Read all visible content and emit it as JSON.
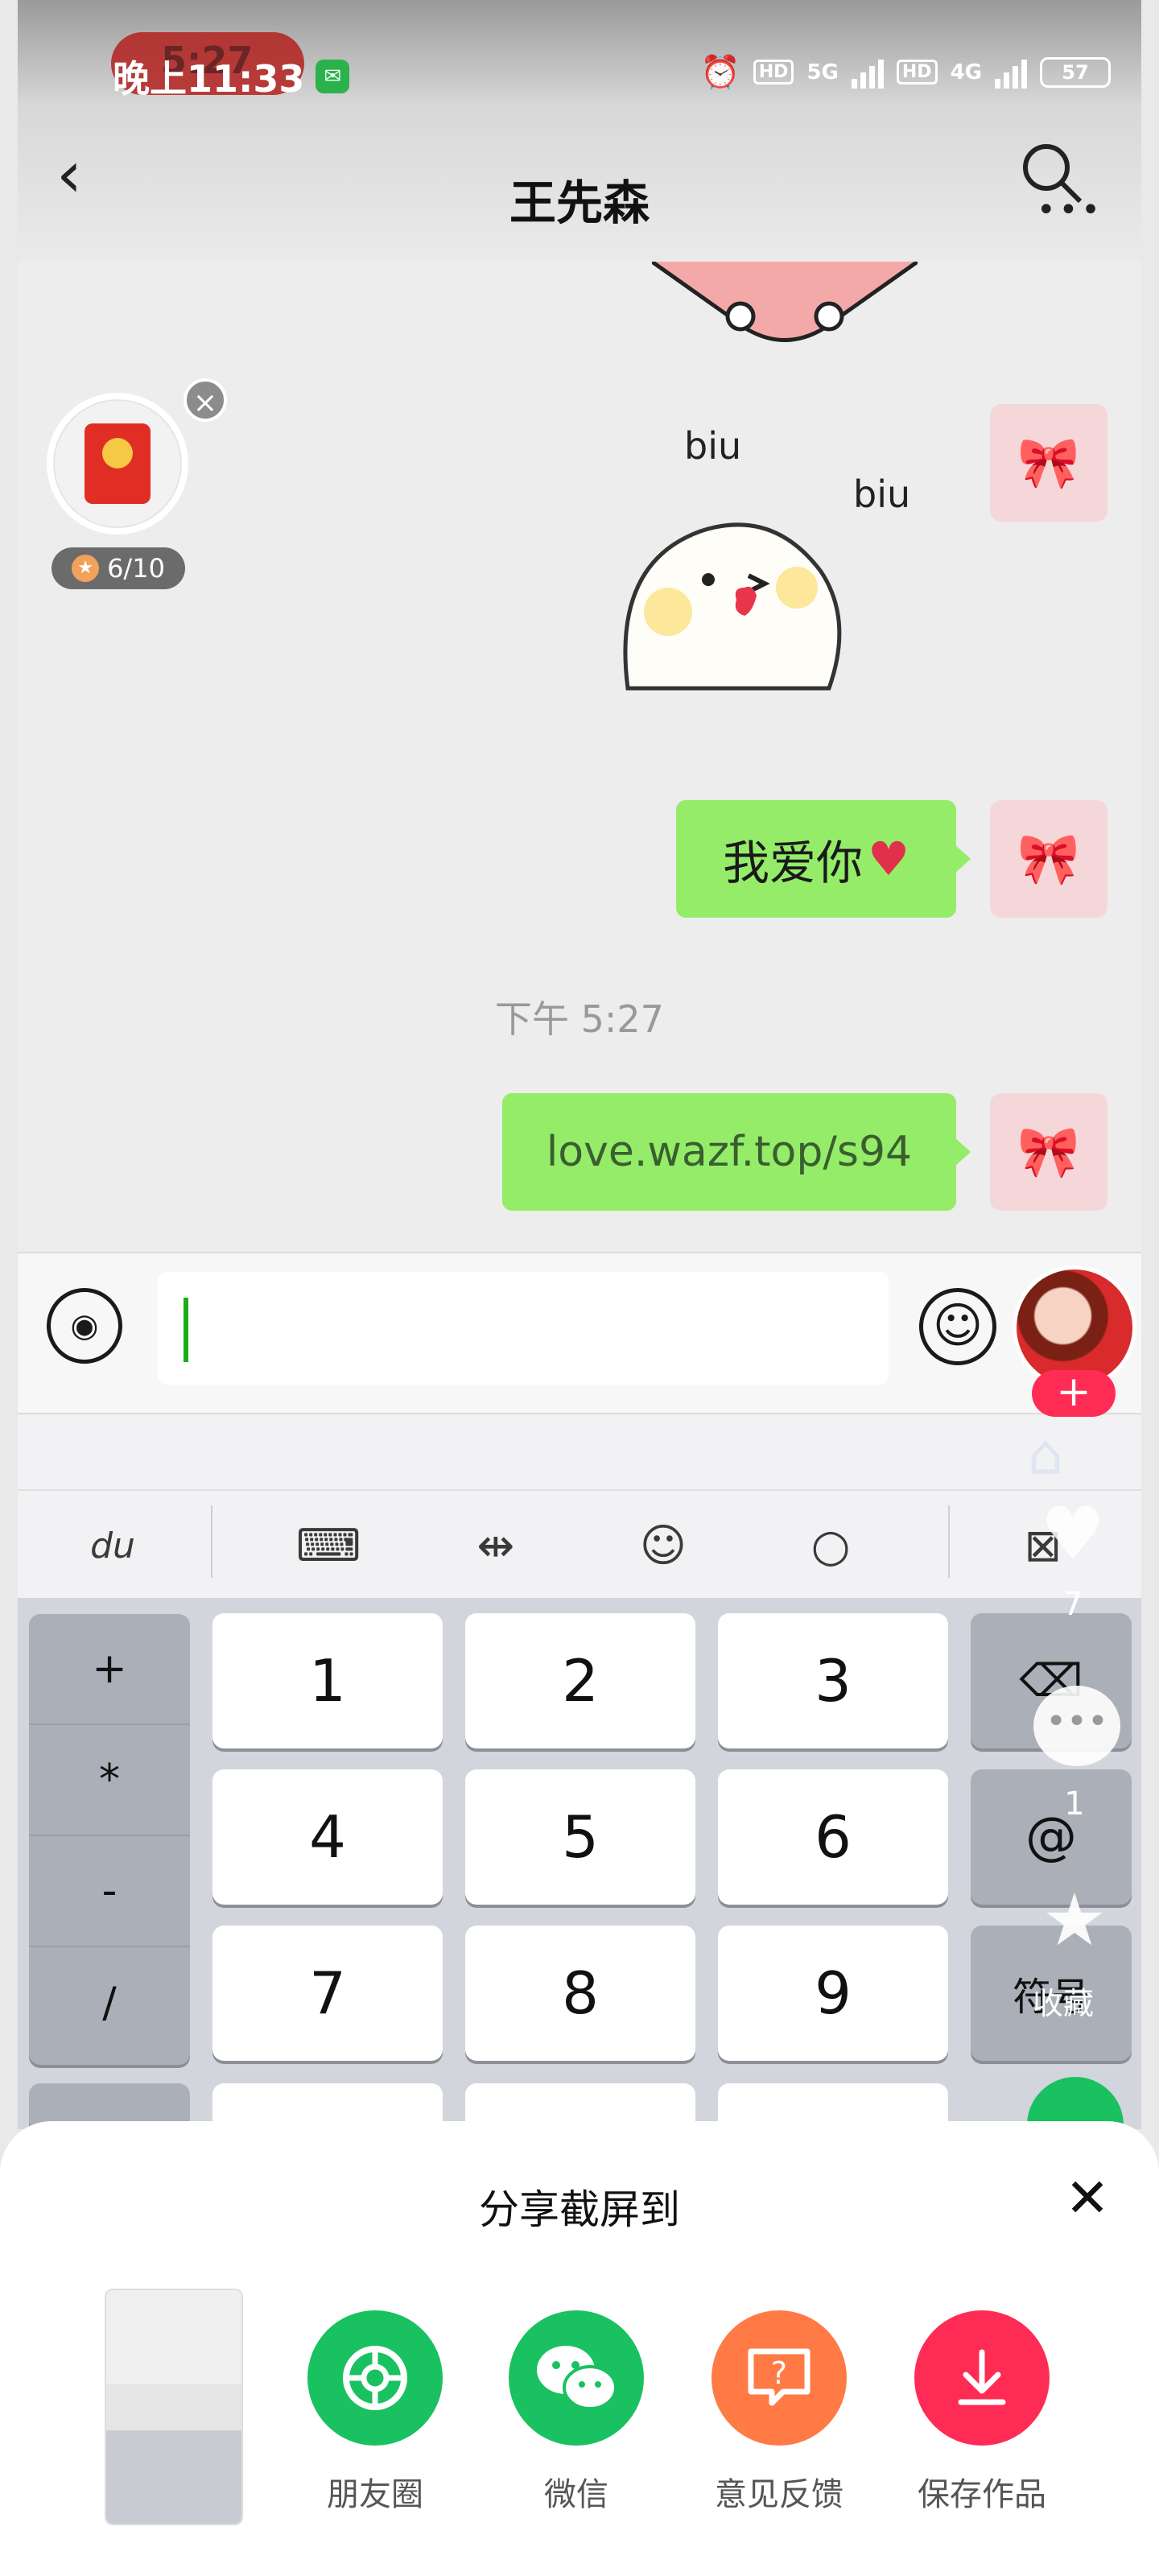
{
  "status_bar": {
    "recording_time": "5:27",
    "time": "晚上11:33",
    "network_1": "5G",
    "network_2": "4G",
    "hd": "HD",
    "battery": "57"
  },
  "header": {
    "title": "王先森"
  },
  "chat": {
    "red_packet_progress": "6/10",
    "sticker_text_1": "biu",
    "sticker_text_2": "biu",
    "message_1": "我爱你",
    "timestamp": "下午 5:27",
    "message_2": "love.wazf.top/s94"
  },
  "keyboard": {
    "brand": "du",
    "symbols": [
      "+",
      "*",
      "-",
      "/"
    ],
    "digits": [
      "1",
      "2",
      "3",
      "4",
      "5",
      "6",
      "7",
      "8",
      "9"
    ],
    "at_key": "@",
    "symbol_key": "符号"
  },
  "overlay": {
    "like_count": "7",
    "comment_count": "1",
    "favorite_label": "收藏"
  },
  "share_sheet": {
    "title": "分享截屏到",
    "targets": [
      {
        "label": "朋友圈",
        "color": "#19c161"
      },
      {
        "label": "微信",
        "color": "#19c161"
      },
      {
        "label": "意见反馈",
        "color": "#ff7a45"
      },
      {
        "label": "保存作品",
        "color": "#fe2c55"
      }
    ]
  }
}
